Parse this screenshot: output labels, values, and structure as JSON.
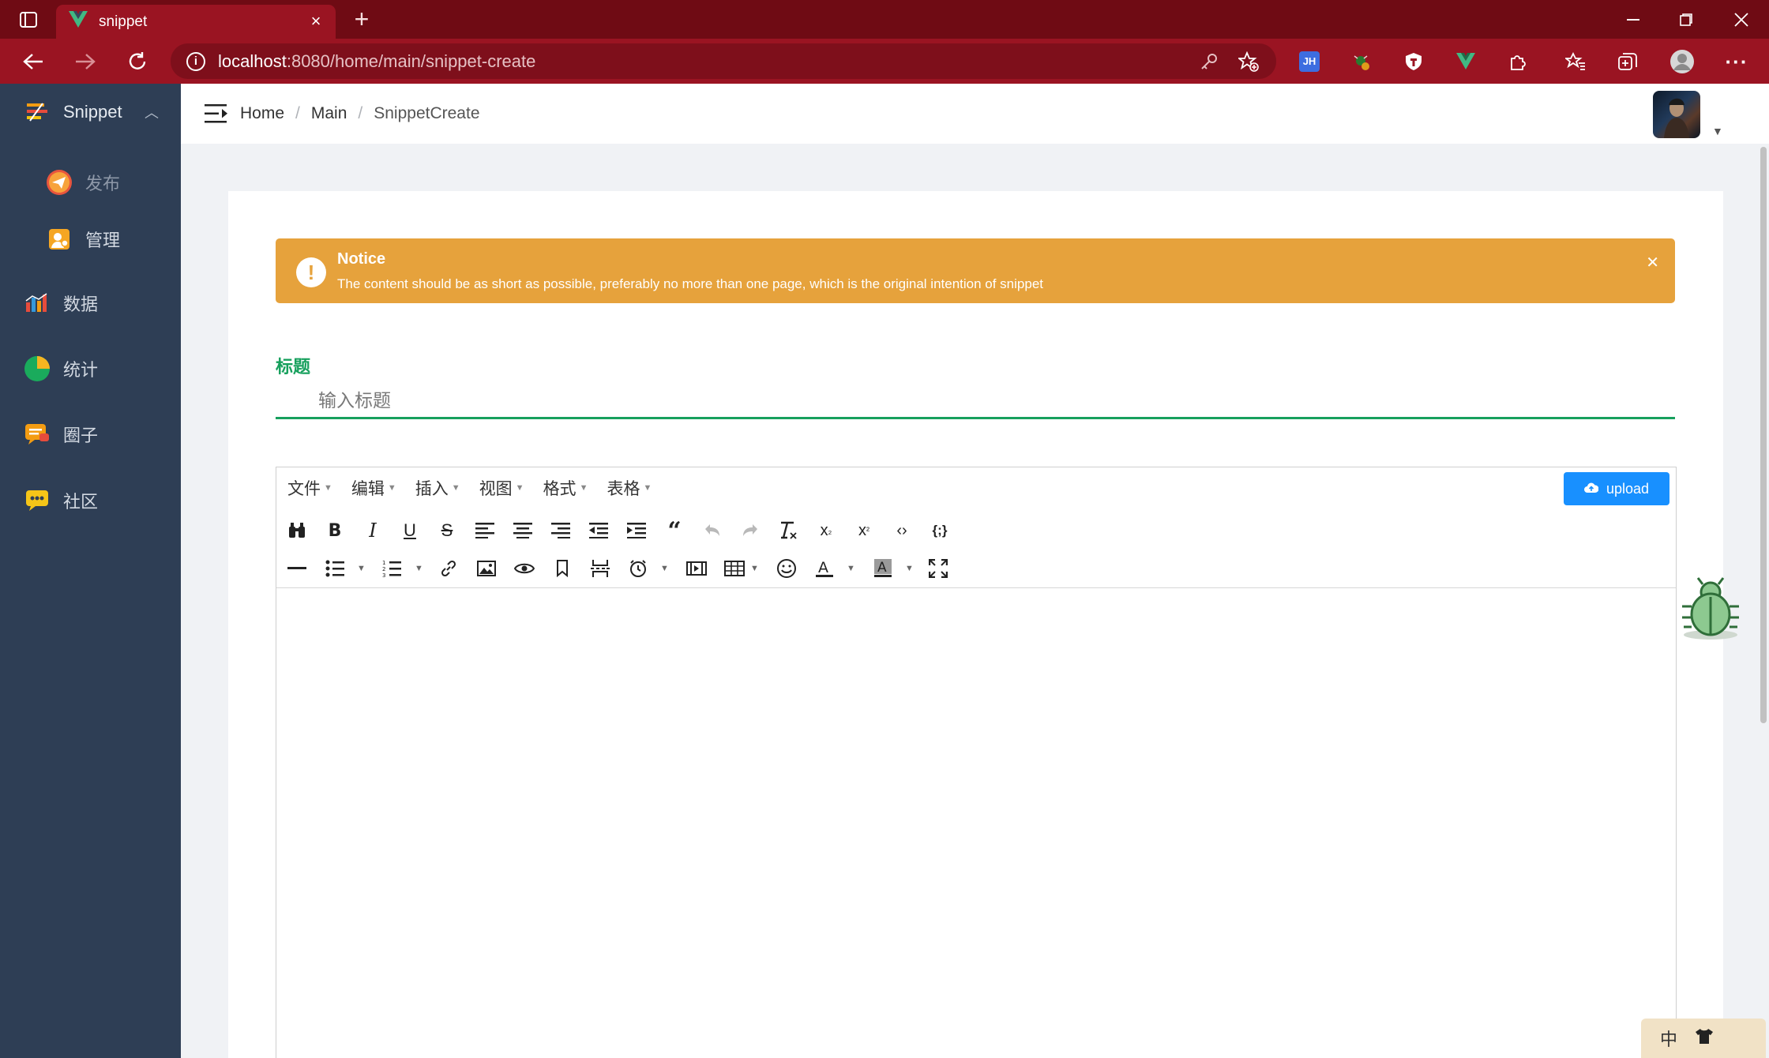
{
  "browser": {
    "tab_title": "snippet",
    "url_host": "localhost",
    "url_rest": ":8080/home/main/snippet-create",
    "extensions": [
      "jh-extension-icon",
      "bug-extension-icon",
      "shield-extension-icon",
      "vue-devtools-icon",
      "puzzle-icon"
    ],
    "jh_label": "JH",
    "accent": "#9a1422",
    "tabbar_color": "#6f0b14"
  },
  "sidebar": {
    "items": [
      {
        "label": "Snippet"
      },
      {
        "label": "发布"
      },
      {
        "label": "管理"
      },
      {
        "label": "数据"
      },
      {
        "label": "统计"
      },
      {
        "label": "圈子"
      },
      {
        "label": "社区"
      }
    ],
    "bg_color": "#2e3e55"
  },
  "header": {
    "breadcrumb": [
      "Home",
      "Main",
      "SnippetCreate"
    ],
    "separator": "/"
  },
  "notice": {
    "title": "Notice",
    "description": "The content should be as short as possible, preferably no more than one page, which is the original intention of snippet",
    "color": "#e6a23c"
  },
  "form": {
    "title_label": "标题",
    "title_placeholder": "输入标题",
    "title_value": "",
    "accent": "#17a05d"
  },
  "editor": {
    "menus": [
      "文件",
      "编辑",
      "插入",
      "视图",
      "格式",
      "表格"
    ],
    "upload_label": "upload",
    "upload_color": "#1890ff",
    "toolbar_row1": [
      "find-replace",
      "bold",
      "italic",
      "underline",
      "strikethrough",
      "align-left",
      "align-center",
      "align-right",
      "outdent",
      "indent",
      "blockquote",
      "undo",
      "redo",
      "remove-format",
      "subscript",
      "superscript",
      "code",
      "code-sample"
    ],
    "toolbar_row2": [
      "horizontal-rule",
      "bullet-list",
      "numbered-list",
      "link",
      "image",
      "preview",
      "bookmark",
      "page-break",
      "insert-datetime",
      "media",
      "table",
      "emoticons",
      "text-color",
      "background-color",
      "fullscreen"
    ]
  },
  "ime": {
    "label": "中"
  }
}
